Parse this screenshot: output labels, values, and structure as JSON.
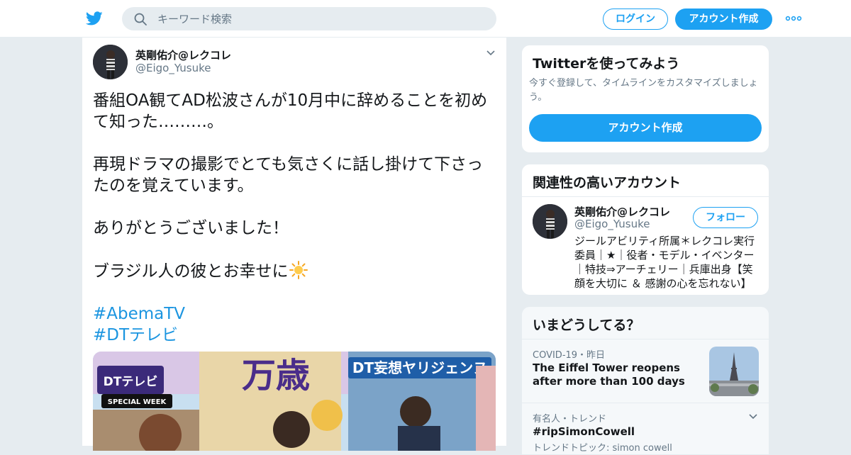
{
  "header": {
    "search_placeholder": "キーワード検索",
    "login_label": "ログイン",
    "signup_label": "アカウント作成"
  },
  "tweet": {
    "author_name": "英剛佑介@レクコレ",
    "author_handle": "@Eigo_Yusuke",
    "lines": [
      "番組OA観てAD松波さんが10月中に辞めることを初めて知った………。",
      "再現ドラマの撮影でとても気さくに話し掛けて下さったのを覚えています。",
      "ありがとうございました！",
      "ブラジル人の彼とお幸せに"
    ],
    "hashtags": [
      "#AbemaTV",
      "#DTテレビ"
    ],
    "media": {
      "badge_left": "DTテレビ",
      "title_banner": "DT妄想ヤリジェンヌ",
      "big_text": "万歳",
      "special_week": "SPECIAL WEEK"
    }
  },
  "sidebar": {
    "signup_card": {
      "title": "Twitterを使ってみよう",
      "subtitle": "今すぐ登録して、タイムラインをカスタマイズしましょう。",
      "button": "アカウント作成"
    },
    "relevant": {
      "title": "関連性の高いアカウント",
      "name": "英剛佑介@レクコレ",
      "handle": "@Eigo_Yusuke",
      "follow_label": "フォロー",
      "bio": "ジールアビリティ所属＊レクコレ実行委員｜★｜役者・モデル・イベンター｜特技⇒アーチェリー｜兵庫出身【笑顔を大切に ＆ 感謝の心を忘れない】"
    },
    "trends": {
      "title": "いまどうしてる？",
      "items": [
        {
          "meta": "COVID-19・昨日",
          "title": "The Eiffel Tower reopens after more than 100 days"
        },
        {
          "meta": "有名人・トレンド",
          "title": "#ripSimonCowell",
          "sub": "トレンドトピック: simon cowell"
        }
      ]
    }
  },
  "colors": {
    "accent": "#1da1f2",
    "background": "#e6ecf0",
    "link": "#1b95e0",
    "secondary_text": "#657786"
  }
}
